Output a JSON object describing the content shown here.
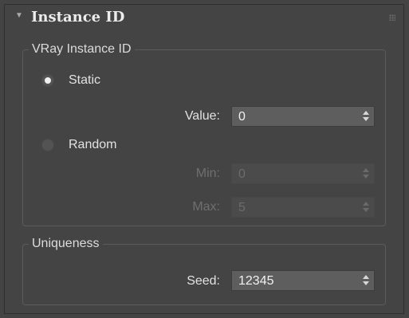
{
  "rollout": {
    "title": "Instance ID",
    "expanded": true
  },
  "vray_instance_id": {
    "group_label": "VRay Instance ID",
    "mode_selected": "static",
    "static": {
      "label": "Static",
      "value_label": "Value:",
      "value": "0"
    },
    "random": {
      "label": "Random",
      "min_label": "Min:",
      "min": "0",
      "max_label": "Max:",
      "max": "5"
    }
  },
  "uniqueness": {
    "group_label": "Uniqueness",
    "seed_label": "Seed:",
    "seed": "12345"
  },
  "colors": {
    "background": "#444444",
    "field_bg": "#5e5e5e",
    "disabled_text": "#6f6f6f"
  }
}
